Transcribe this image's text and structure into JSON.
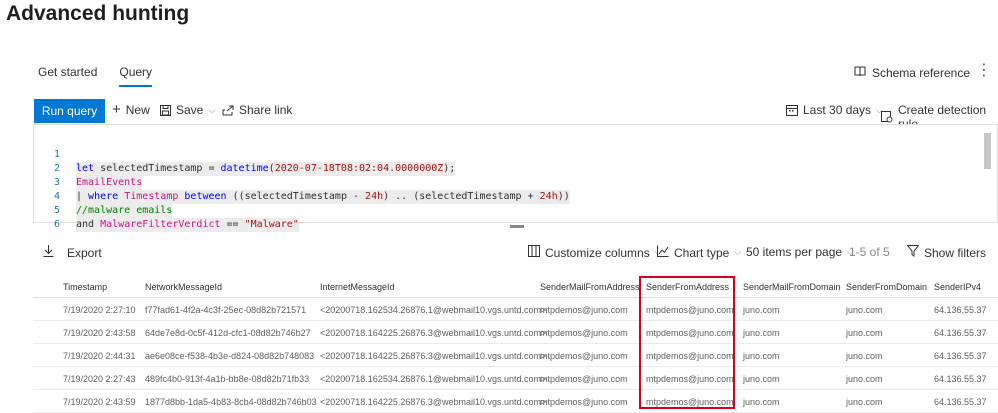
{
  "page": {
    "title": "Advanced hunting"
  },
  "tabs": [
    {
      "label": "Get started",
      "active": false
    },
    {
      "label": "Query",
      "active": true
    }
  ],
  "schema_reference": {
    "label": "Schema reference",
    "icon": "book-icon"
  },
  "toolbar": {
    "run_query": "Run query",
    "new": "New",
    "save": "Save",
    "share_link": "Share link",
    "time_range": "Last 30 days",
    "create_detection_rule": "Create detection rule"
  },
  "editor": {
    "lines": [
      {
        "num": "1",
        "text": "let selectedTimestamp = datetime(2020-07-18T08:02:04.0000000Z);"
      },
      {
        "num": "2",
        "text": "EmailEvents"
      },
      {
        "num": "3",
        "text": "| where Timestamp between ((selectedTimestamp - 24h) .. (selectedTimestamp + 24h))"
      },
      {
        "num": "4",
        "text": "//malware emails"
      },
      {
        "num": "5",
        "text": "and MalwareFilterVerdict == \"Malware\""
      },
      {
        "num": "6",
        "text": ""
      }
    ]
  },
  "results": {
    "export": "Export",
    "customize_columns": "Customize columns",
    "chart_type": "Chart type",
    "items_per_page": "50 items per page",
    "range": "1-5 of 5",
    "show_filters": "Show filters"
  },
  "table": {
    "headers": [
      "Timestamp",
      "NetworkMessageId",
      "InternetMessageId",
      "SenderMailFromAddress",
      "SenderFromAddress",
      "SenderMailFromDomain",
      "SenderFromDomain",
      "SenderIPv4"
    ],
    "rows": [
      [
        "7/19/2020 2:27:10",
        "f77fad61-4f2a-4c3f-25ec-08d82b721571",
        "<20200718.162534.26876.1@webmail10.vgs.untd.com>",
        "mtpdemos@juno.com",
        "mtpdemos@juno.com",
        "juno.com",
        "juno.com",
        "64.136.55.37"
      ],
      [
        "7/19/2020 2:43:58",
        "64de7e8d-0c5f-412d-cfc1-08d82b746b27",
        "<20200718.164225.26876.3@webmail10.vgs.untd.com>",
        "mtpdemos@juno.com",
        "mtpdemos@juno.com",
        "juno.com",
        "juno.com",
        "64.136.55.37"
      ],
      [
        "7/19/2020 2:44:31",
        "ae6e08ce-f538-4b3e-d824-08d82b748083",
        "<20200718.164225.26876.3@webmail10.vgs.untd.com>",
        "mtpdemos@juno.com",
        "mtpdemos@juno.com",
        "juno.com",
        "juno.com",
        "64.136.55.37"
      ],
      [
        "7/19/2020 2:27:43",
        "489fc4b0-913f-4a1b-bb8e-08d82b71fb33",
        "<20200718.162534.26876.1@webmail10.vgs.untd.com>",
        "mtpdemos@juno.com",
        "mtpdemos@juno.com",
        "juno.com",
        "juno.com",
        "64.136.55.37"
      ],
      [
        "7/19/2020 2:43:59",
        "1877d8bb-1da5-4b83-8cb4-08d82b746b03",
        "<20200718.164225.26876.3@webmail10.vgs.untd.com>",
        "mtpdemos@juno.com",
        "mtpdemos@juno.com",
        "juno.com",
        "juno.com",
        "64.136.55.37"
      ]
    ]
  },
  "colors": {
    "accent": "#0078d4",
    "highlight": "#d9001b"
  }
}
